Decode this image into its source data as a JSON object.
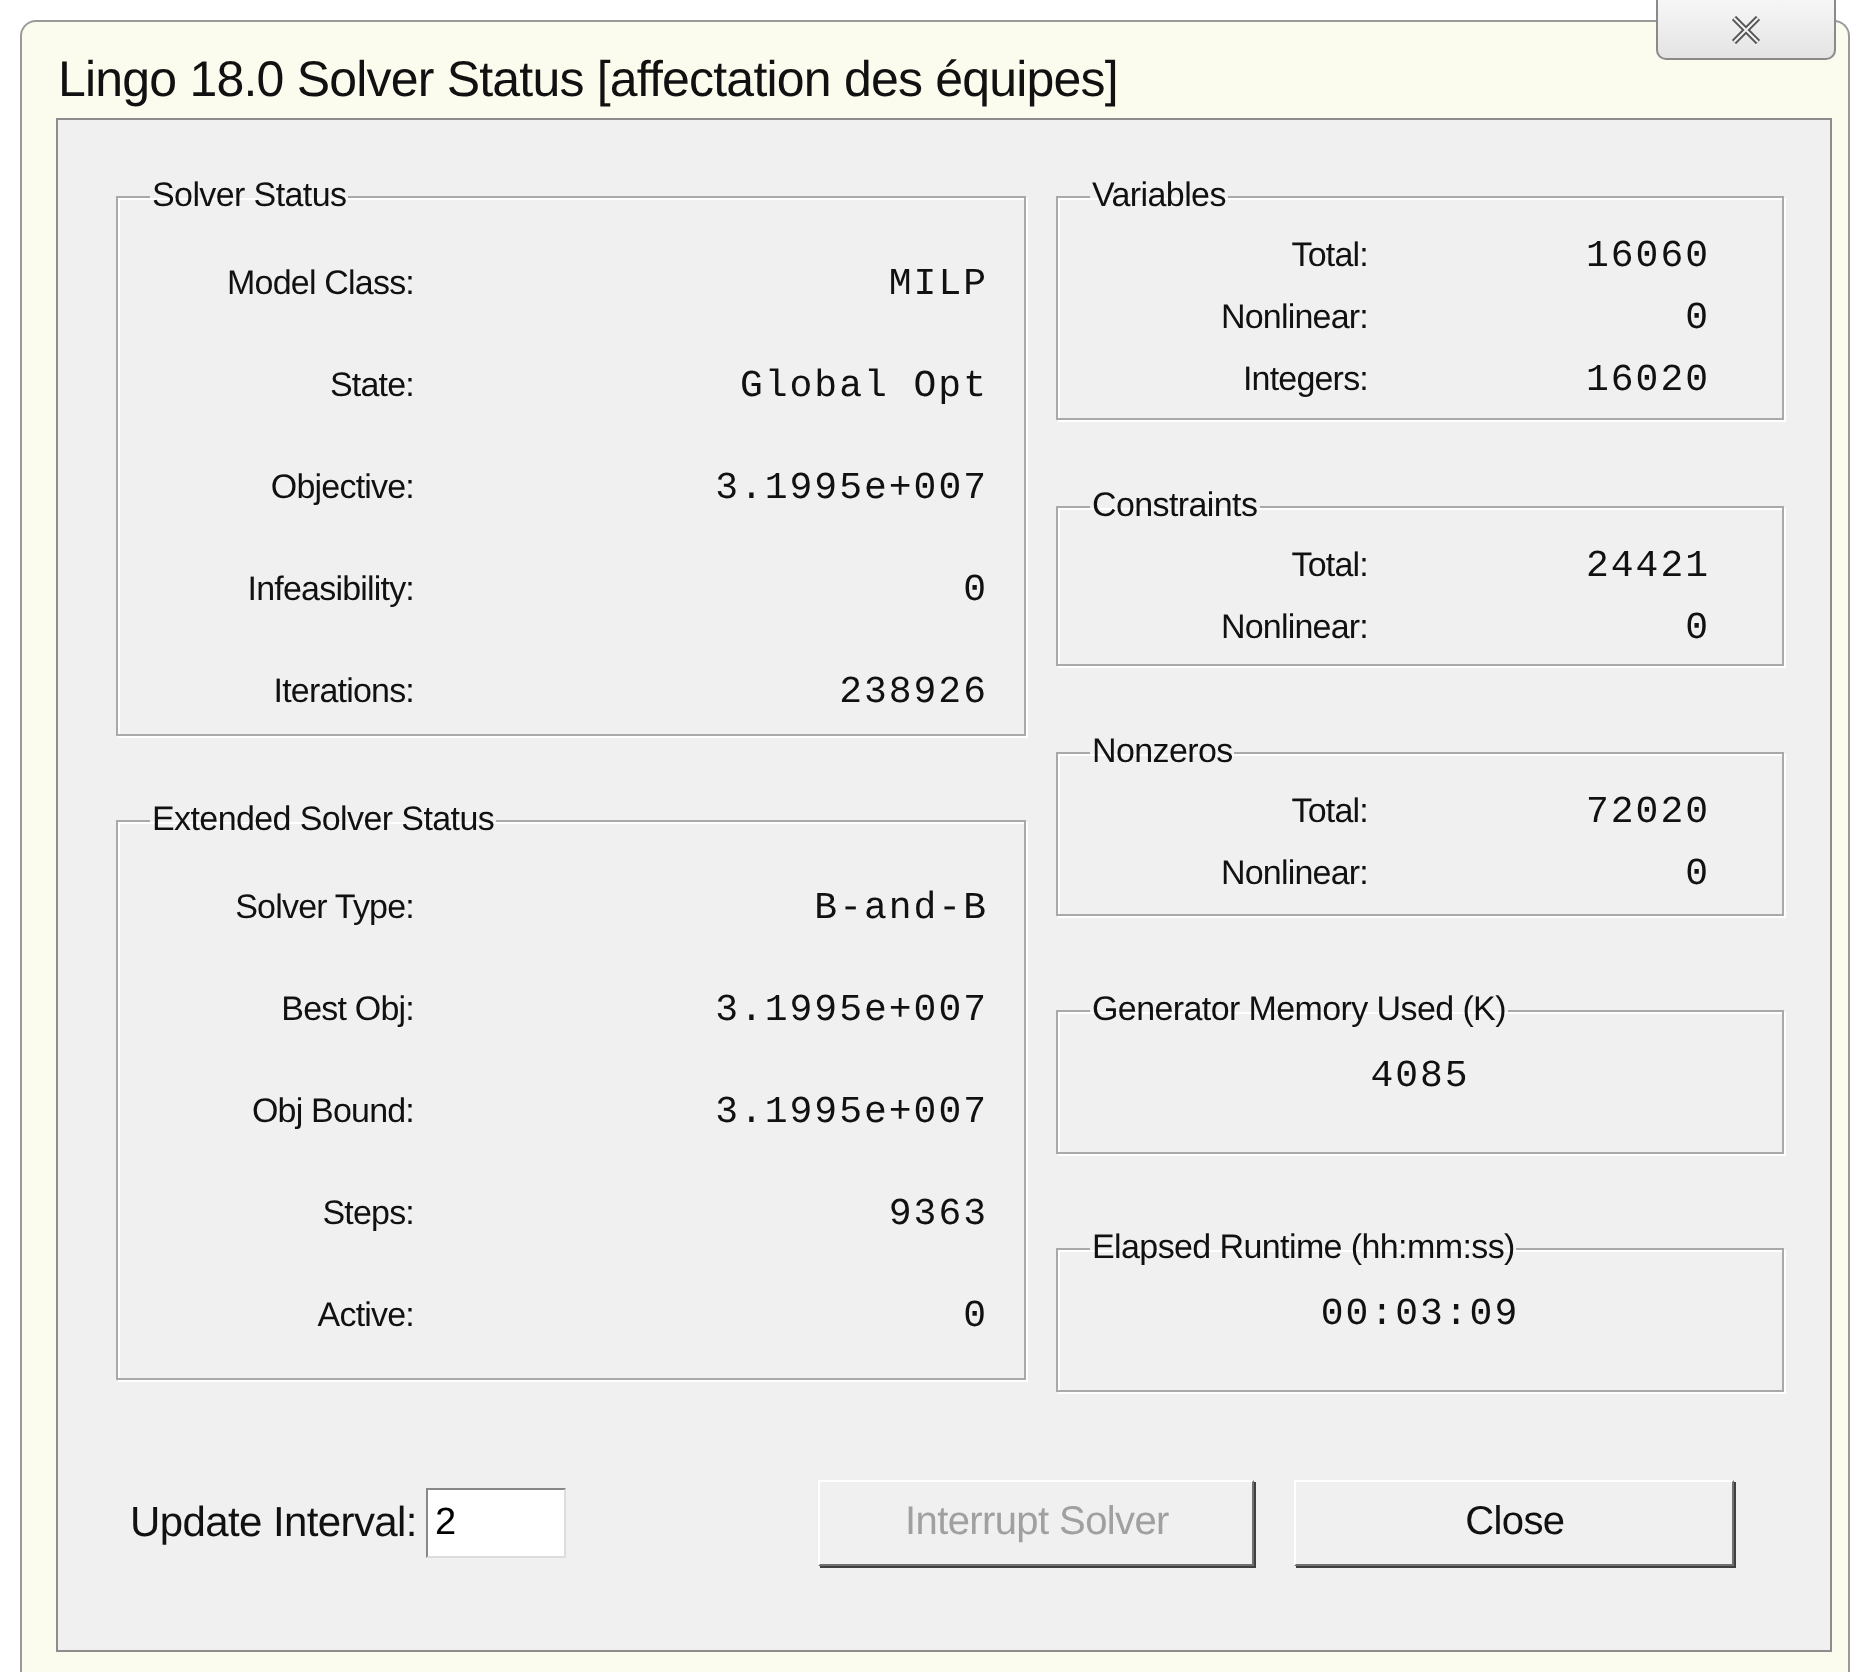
{
  "window": {
    "title": "Lingo 18.0 Solver Status [affectation des équipes]"
  },
  "left_groups": [
    {
      "title": "Solver Status",
      "rows": [
        {
          "label": "Model Class:",
          "value": "MILP"
        },
        {
          "label": "State:",
          "value": "Global Opt"
        },
        {
          "label": "Objective:",
          "value": "3.1995e+007"
        },
        {
          "label": "Infeasibility:",
          "value": "0"
        },
        {
          "label": "Iterations:",
          "value": "238926"
        }
      ]
    },
    {
      "title": "Extended Solver Status",
      "rows": [
        {
          "label": "Solver Type:",
          "value": "B-and-B"
        },
        {
          "label": "Best Obj:",
          "value": "3.1995e+007"
        },
        {
          "label": "Obj Bound:",
          "value": "3.1995e+007"
        },
        {
          "label": "Steps:",
          "value": "9363"
        },
        {
          "label": "Active:",
          "value": "0"
        }
      ]
    }
  ],
  "right_groups": [
    {
      "title": "Variables",
      "kind": "rows",
      "rows": [
        {
          "label": "Total:",
          "value": "16060"
        },
        {
          "label": "Nonlinear:",
          "value": "0"
        },
        {
          "label": "Integers:",
          "value": "16020"
        }
      ]
    },
    {
      "title": "Constraints",
      "kind": "rows",
      "rows": [
        {
          "label": "Total:",
          "value": "24421"
        },
        {
          "label": "Nonlinear:",
          "value": "0"
        }
      ]
    },
    {
      "title": "Nonzeros",
      "kind": "rows",
      "rows": [
        {
          "label": "Total:",
          "value": "72020"
        },
        {
          "label": "Nonlinear:",
          "value": "0"
        }
      ]
    },
    {
      "title": "Generator Memory Used (K)",
      "kind": "single",
      "value": "4085"
    },
    {
      "title": "Elapsed Runtime (hh:mm:ss)",
      "kind": "single",
      "value": "00:03:09"
    }
  ],
  "update_interval": {
    "label": "Update Interval:",
    "value": "2"
  },
  "buttons": [
    {
      "label": "Interrupt Solver",
      "disabled": true
    },
    {
      "label": "Close",
      "disabled": false
    }
  ]
}
